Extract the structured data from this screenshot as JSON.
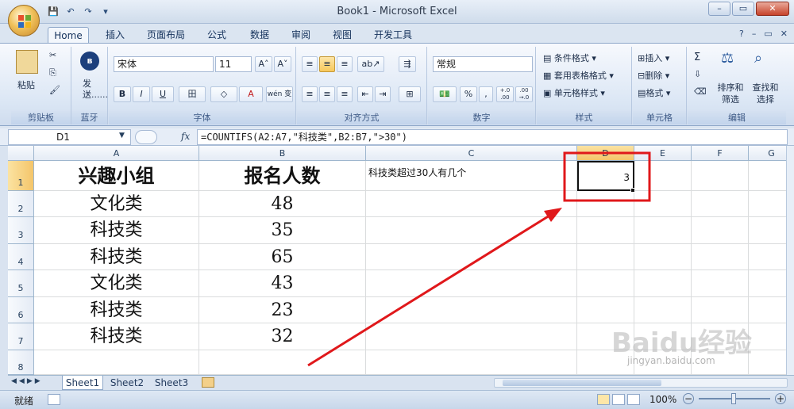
{
  "window": {
    "title": "Book1 - Microsoft Excel",
    "minimize": "–",
    "restore": "▭",
    "close": "✕"
  },
  "qat": {
    "save": "💾",
    "undo": "↶",
    "redo": "↷",
    "more": "▾"
  },
  "tabs": [
    "Home",
    "插入",
    "页面布局",
    "公式",
    "数据",
    "审阅",
    "视图",
    "开发工具"
  ],
  "tabs_right": {
    "help": "?",
    "min": "–",
    "restore": "▭",
    "close": "✕"
  },
  "ribbon": {
    "clipboard": {
      "label": "剪贴板",
      "paste": "粘贴",
      "cut": "✂",
      "copy": "⎘",
      "brush": "🖌"
    },
    "bluetooth": {
      "label": "蓝牙",
      "send": "发送......"
    },
    "font": {
      "label": "字体",
      "font_name": "宋体",
      "font_size": "11",
      "grow": "A˄",
      "shrink": "A˅",
      "bold": "B",
      "italic": "I",
      "underline": "U",
      "border": "田",
      "fill": "◇",
      "color": "A",
      "phonetic": "wén 变"
    },
    "alignment": {
      "label": "对齐方式"
    },
    "number": {
      "label": "数字",
      "format": "常规",
      "currency": "💵",
      "percent": "%",
      "comma": ",",
      "inc": "+.0 .00",
      "dec": ".00 →.0"
    },
    "styles": {
      "label": "样式",
      "conditional": "条件格式",
      "table": "套用表格格式",
      "cell": "单元格样式"
    },
    "cells": {
      "label": "单元格",
      "insert": "插入",
      "delete": "删除",
      "format": "格式"
    },
    "editing": {
      "label": "编辑",
      "sum": "Σ",
      "fill": "⇩",
      "clear": "⌫",
      "sort": "排序和筛选",
      "find": "查找和选择"
    }
  },
  "formula": {
    "name_box": "D1",
    "fx": "fx",
    "content": "=COUNTIFS(A2:A7,\"科技类\",B2:B7,\">30\")"
  },
  "columns": [
    "A",
    "B",
    "C",
    "D",
    "E",
    "F",
    "G"
  ],
  "rows": [
    "1",
    "2",
    "3",
    "4",
    "5",
    "6",
    "7",
    "8"
  ],
  "cells": {
    "A1": "兴趣小组",
    "B1": "报名人数",
    "C1": "科技类超过30人有几个",
    "D1": "3",
    "A2": "文化类",
    "B2": "48",
    "A3": "科技类",
    "B3": "35",
    "A4": "科技类",
    "B4": "65",
    "A5": "文化类",
    "B5": "43",
    "A6": "科技类",
    "B6": "23",
    "A7": "科技类",
    "B7": "32"
  },
  "sheets": [
    "Sheet1",
    "Sheet2",
    "Sheet3"
  ],
  "status": {
    "ready": "就绪",
    "zoom": "100%",
    "minus": "−",
    "plus": "+"
  },
  "watermark": "Baidu经验",
  "watermark_url": "jingyan.baidu.com",
  "colors": {
    "highlight_box": "#e0181b",
    "arrow": "#e0181b",
    "selected_header": "#f4c56a"
  }
}
